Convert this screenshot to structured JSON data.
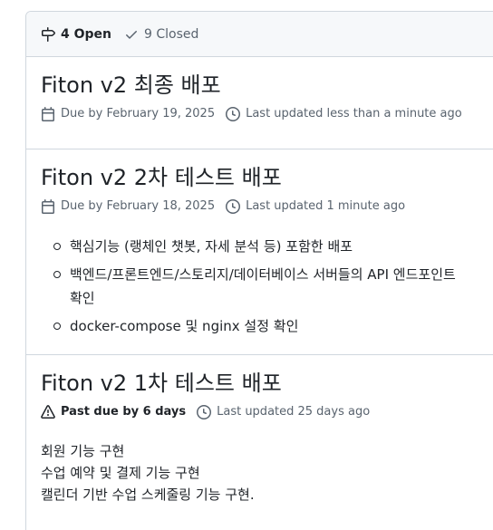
{
  "header": {
    "open_label": "4 Open",
    "closed_label": "9 Closed"
  },
  "milestones": [
    {
      "title": "Fiton v2 최종 배포",
      "due": "Due by February 19, 2025",
      "updated": "Last updated less than a minute ago"
    },
    {
      "title": "Fiton v2 2차 테스트 배포",
      "due": "Due by February 18, 2025",
      "updated": "Last updated 1 minute ago",
      "items": [
        "핵심기능 (랭체인 챗봇, 자세 분석 등) 포함한 배포",
        "백엔드/프론트엔드/스토리지/데이터베이스 서버들의 API 엔드포인트 확인",
        "docker-compose 및 nginx 설정 확인"
      ]
    },
    {
      "title": "Fiton v2 1차 테스트 배포",
      "past_due": "Past due by 6 days",
      "updated": "Last updated 25 days ago",
      "lines": [
        "회원 기능 구현",
        "수업 예약 및 결제 기능 구현",
        "캘린더 기반 수업 스케줄링 기능 구현."
      ]
    }
  ],
  "colors": {
    "accent_progress": "#bf8700",
    "past_due_icon": "#1f2328",
    "muted_text": "#59636e"
  },
  "icons": {
    "open": "milestone-icon",
    "closed": "check-icon",
    "due": "calendar-icon",
    "updated": "clock-icon",
    "past_due": "alert-icon"
  }
}
